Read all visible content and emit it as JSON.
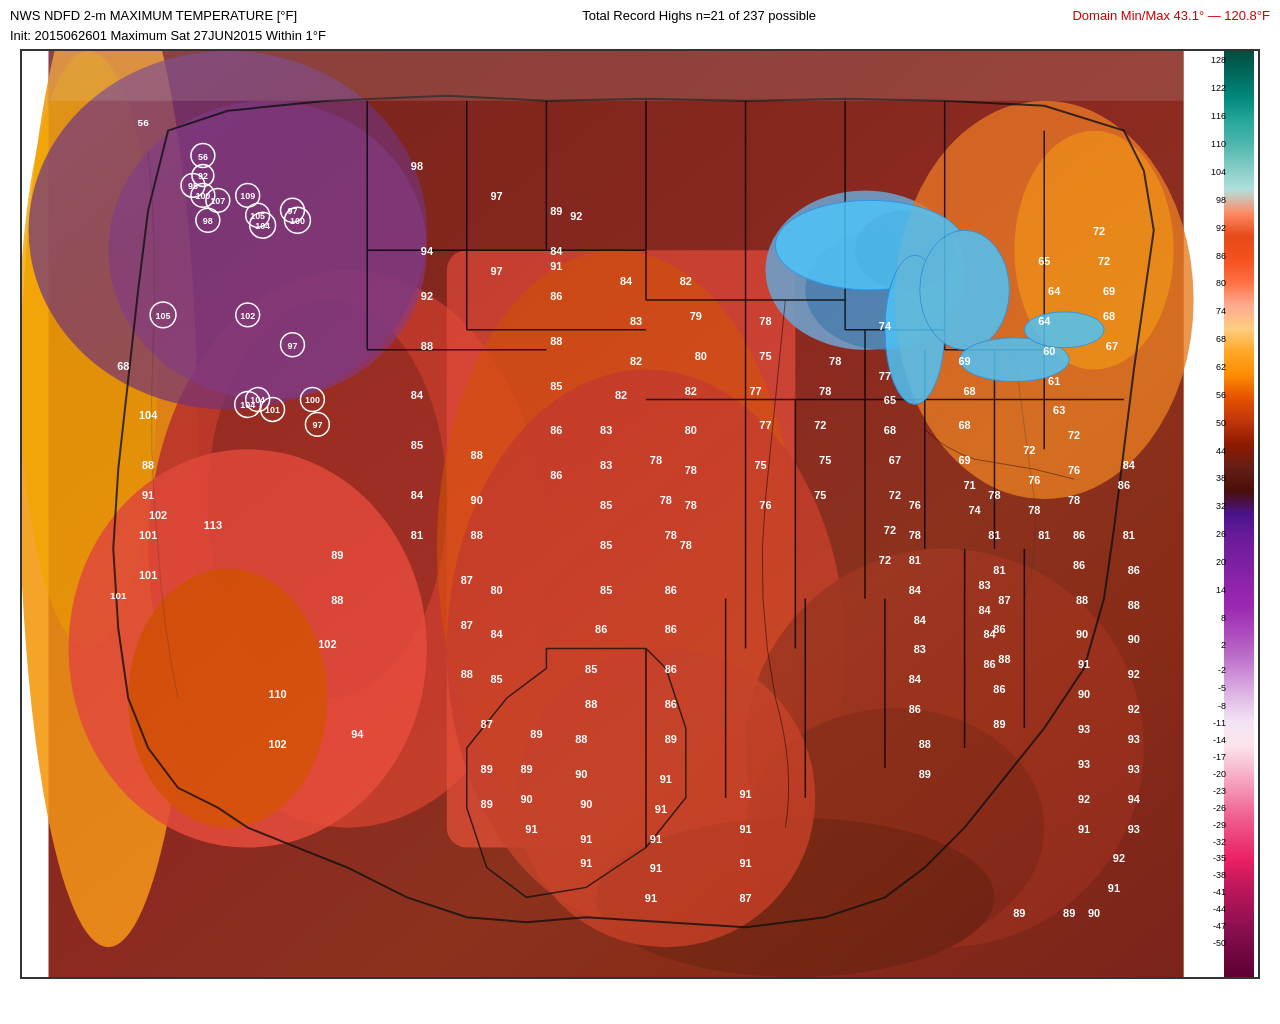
{
  "header": {
    "title_line1": "NWS NDFD 2-m MAXIMUM TEMPERATURE [°F]",
    "title_line2": "Init: 2015062601 Maximum Sat 27JUN2015  Within 1°F",
    "domain_label": "Domain Min/Max 43.1° — 120.8°F",
    "record_label": "Total Record Highs n=21 of 237 possible"
  },
  "legend": {
    "entries": [
      {
        "value": 128,
        "color": "#004d40"
      },
      {
        "value": 122,
        "color": "#00695c"
      },
      {
        "value": 116,
        "color": "#00897b"
      },
      {
        "value": 110,
        "color": "#26a69a"
      },
      {
        "value": 104,
        "color": "#4db6ac"
      },
      {
        "value": 98,
        "color": "#80cbc4"
      },
      {
        "value": 92,
        "color": "#b2dfdb"
      },
      {
        "value": 86,
        "color": "#e64a19"
      },
      {
        "value": 80,
        "color": "#f4511e"
      },
      {
        "value": 74,
        "color": "#ff7043"
      },
      {
        "value": 68,
        "color": "#ff8a65"
      },
      {
        "value": 62,
        "color": "#ffab91"
      },
      {
        "value": 56,
        "color": "#ffccbc"
      },
      {
        "value": 50,
        "color": "#fff3e0"
      },
      {
        "value": 44,
        "color": "#ffe0b2"
      },
      {
        "value": 38,
        "color": "#ffcc80"
      },
      {
        "value": 32,
        "color": "#ffa726"
      },
      {
        "value": 26,
        "color": "#fb8c00"
      },
      {
        "value": 20,
        "color": "#e65100"
      },
      {
        "value": 14,
        "color": "#bf360c"
      },
      {
        "value": 8,
        "color": "#8d1a00"
      },
      {
        "value": 2,
        "color": "#4a148c"
      },
      {
        "value": -2,
        "color": "#6a1b9a"
      },
      {
        "value": -5,
        "color": "#7b1fa2"
      },
      {
        "value": -8,
        "color": "#8e24aa"
      },
      {
        "value": -11,
        "color": "#9c27b0"
      },
      {
        "value": -14,
        "color": "#ab47bc"
      },
      {
        "value": -17,
        "color": "#ba68c8"
      },
      {
        "value": -20,
        "color": "#ce93d8"
      },
      {
        "value": -23,
        "color": "#e1bee7"
      },
      {
        "value": -26,
        "color": "#f3e5f5"
      },
      {
        "value": -29,
        "color": "#fce4ec"
      },
      {
        "value": -32,
        "color": "#f8bbd0"
      },
      {
        "value": -35,
        "color": "#f48fb1"
      },
      {
        "value": -38,
        "color": "#f06292"
      },
      {
        "value": -41,
        "color": "#ec407a"
      },
      {
        "value": -44,
        "color": "#e91e63"
      },
      {
        "value": -47,
        "color": "#c2185b"
      },
      {
        "value": -50,
        "color": "#880e4f"
      }
    ]
  },
  "temperature_points": [
    {
      "x": 8,
      "y": 12,
      "val": "56",
      "circled": false
    },
    {
      "x": 13,
      "y": 15,
      "val": "95",
      "circled": true
    },
    {
      "x": 14,
      "y": 14,
      "val": "92",
      "circled": true
    },
    {
      "x": 14,
      "y": 18,
      "val": "100",
      "circled": true
    },
    {
      "x": 15,
      "y": 21,
      "val": "98",
      "circled": true
    },
    {
      "x": 17,
      "y": 17,
      "val": "107",
      "circled": true
    },
    {
      "x": 20,
      "y": 15,
      "val": "109",
      "circled": true
    },
    {
      "x": 25,
      "y": 14,
      "val": "97",
      "circled": true
    },
    {
      "x": 22,
      "y": 19,
      "val": "105",
      "circled": true
    },
    {
      "x": 22,
      "y": 21,
      "val": "104",
      "circled": true
    },
    {
      "x": 26,
      "y": 20,
      "val": "100",
      "circled": true
    },
    {
      "x": 27,
      "y": 21,
      "val": "101",
      "circled": true
    },
    {
      "x": 11,
      "y": 28,
      "val": "105",
      "circled": true
    },
    {
      "x": 20,
      "y": 29,
      "val": "102",
      "circled": true
    },
    {
      "x": 26,
      "y": 31,
      "val": "97",
      "circled": true
    },
    {
      "x": 20,
      "y": 37,
      "val": "104",
      "circled": true
    },
    {
      "x": 22,
      "y": 37,
      "val": "104",
      "circled": false
    },
    {
      "x": 23,
      "y": 38,
      "val": "101",
      "circled": true
    },
    {
      "x": 28,
      "y": 36,
      "val": "100",
      "circled": false
    },
    {
      "x": 30,
      "y": 42,
      "val": "97",
      "circled": true
    }
  ]
}
